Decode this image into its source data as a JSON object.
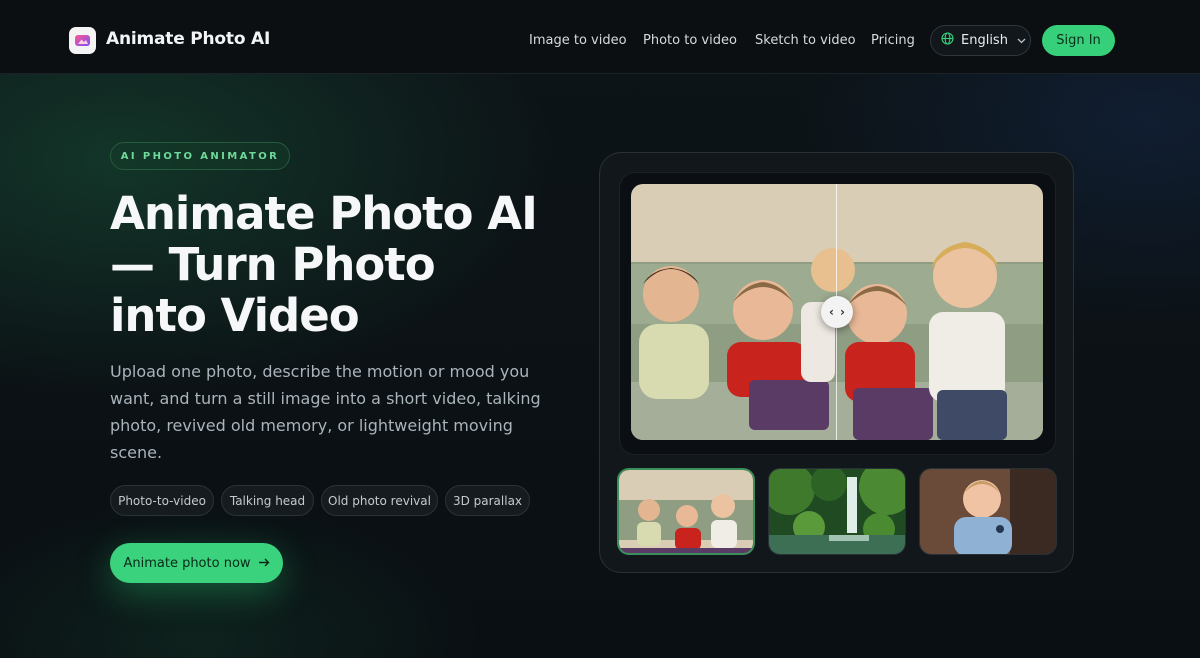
{
  "brand": {
    "name": "Animate Photo AI",
    "logo": "app-logo-icon"
  },
  "nav": {
    "links": [
      "Image to video",
      "Photo to video",
      "Sketch to video",
      "Pricing"
    ],
    "language": "English",
    "sign_in": "Sign In"
  },
  "hero": {
    "eyebrow": "AI PHOTO ANIMATOR",
    "title": "Animate Photo AI — Turn Photo into Video",
    "description": "Upload one photo, describe the motion or mood you want, and turn a still image into a short video, talking photo, revived old memory, or lightweight moving scene.",
    "chips": [
      "Photo-to-video",
      "Talking head",
      "Old photo revival",
      "3D parallax"
    ],
    "cta": "Animate photo now",
    "cta_icon": "arrow-right-icon"
  },
  "preview": {
    "compare_handle": {
      "left": "‹",
      "right": "›"
    },
    "thumbnails": [
      "old-family-photo",
      "waterfall-landscape",
      "smiling-toddler"
    ],
    "active_thumbnail": 0
  },
  "colors": {
    "accent": "#36d07a",
    "background": "#0b1014",
    "header": "#0c0f12"
  }
}
